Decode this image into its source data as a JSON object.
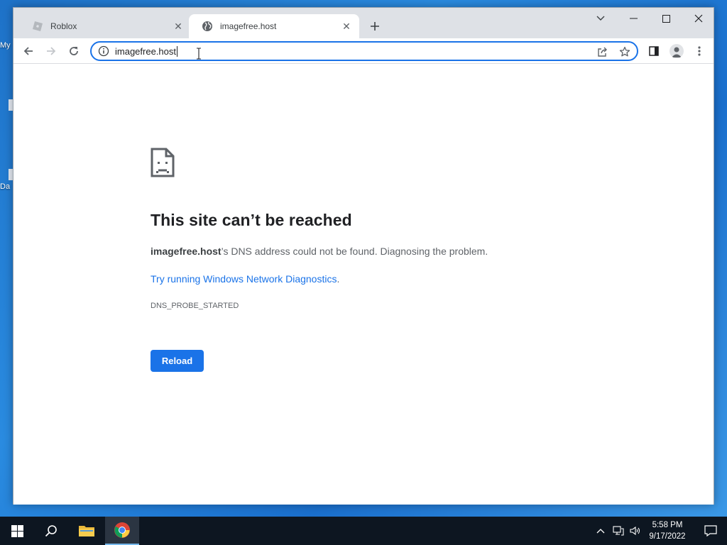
{
  "desktop": {
    "frag_1": "My",
    "frag_2": "Da"
  },
  "browser": {
    "tabs": [
      {
        "title": "Roblox",
        "active": false
      },
      {
        "title": "imagefree.host",
        "active": true
      }
    ],
    "omnibox": {
      "value": "imagefree.host"
    }
  },
  "error_page": {
    "title": "This site can’t be reached",
    "host": "imagefree.host",
    "description_suffix": "’s DNS address could not be found. Diagnosing the problem.",
    "link_text": "Try running Windows Network Diagnostics",
    "link_suffix": ".",
    "error_code": "DNS_PROBE_STARTED",
    "reload_label": "Reload"
  },
  "taskbar": {
    "time": "5:58 PM",
    "date": "9/17/2022"
  },
  "colors": {
    "accent": "#1a73e8",
    "taskbar": "#0d1621",
    "desktop": "#1e72c8"
  },
  "icons": {
    "tab_roblox": "roblox-favicon",
    "tab_active": "globe-icon",
    "page": "sad-document-icon",
    "start": "windows-logo-icon"
  }
}
